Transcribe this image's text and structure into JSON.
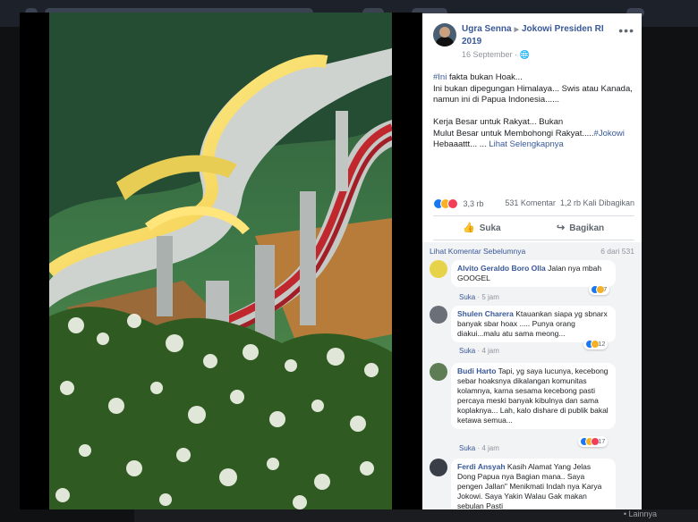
{
  "post": {
    "author": "Ugra Senna",
    "target": "Jokowi Presiden RI 2019",
    "date": "16 September",
    "privacy_icon": "globe-icon",
    "more_label": "•••",
    "hashtag1": "#Ini",
    "line1": " fakta bukan Hoak...",
    "line2": "Ini bukan dipegungan Himalaya... Swis atau Kanada, namun ini di Papua Indonesia......",
    "line3": "Kerja Besar untuk Rakyat... Bukan",
    "line4a": "Mulut Besar untuk Membohongi Rakyat.....",
    "hashtag2": "#Jokowi",
    "line5": "Hebaaattt... ... ",
    "see_more": "Lihat Selengkapnya"
  },
  "reactions": {
    "count": "3,3 rb",
    "comments": "531 Komentar",
    "shares": "1,2 rb Kali Dibagikan"
  },
  "actions": {
    "like": "Suka",
    "share": "Bagikan"
  },
  "comments_header": {
    "previous": "Lihat Komentar Sebelumnya",
    "count": "6 dari 531"
  },
  "comments": [
    {
      "name": "Alvito Geraldo Boro Olla",
      "text": "Jalan nya mbah GOOGEL",
      "like": "Suka",
      "time": "5 jam",
      "reacts": "7"
    },
    {
      "name": "Shulen Charera",
      "text": "Ktauankan siapa yg sbnarx banyak sbar hoax ..... Punya orang diakui...malu atu sama meong...",
      "like": "Suka",
      "time": "4 jam",
      "reacts": "12"
    },
    {
      "name": "Budi Harto",
      "text": "Tapi, yg saya lucunya, kecebong sebar hoaksnya dikalangan komunitas kolamnya, karna sesama kecebong pasti percaya meski banyak kibulnya dan sama koplaknya... Lah, kalo dishare di publik bakal ketawa semua...",
      "like": "Suka",
      "time": "4 jam",
      "reacts": "17"
    },
    {
      "name": "Ferdi Ansyah",
      "text": "Kasih Alamat Yang Jelas Dong Papua nya Bagian mana.. Saya pengen Jallan\" Menikmati Indah nya Karya Jokowi. Saya Yakin Walau Gak makan sebulan Pasti",
      "like": "",
      "time": "",
      "reacts": ""
    }
  ],
  "bottom_text": "• Lainnya"
}
